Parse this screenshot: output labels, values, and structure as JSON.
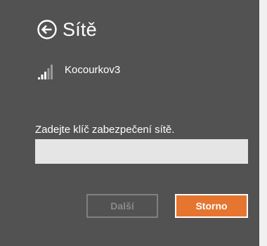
{
  "header": {
    "title": "Sítě",
    "back_icon": "back-arrow-circle-icon"
  },
  "network": {
    "name": "Kocourkov3",
    "signal_icon": "wifi-signal-bars-icon",
    "signal_level": 0.6
  },
  "security_key": {
    "label": "Zadejte klíč zabezpečení sítě.",
    "value": "",
    "placeholder": ""
  },
  "buttons": {
    "next_label": "Další",
    "cancel_label": "Storno"
  },
  "colors": {
    "panel_background": "#525252",
    "accent": "#e5752f",
    "input_background": "#e5e5e5",
    "disabled_text": "#8a8a8a"
  }
}
